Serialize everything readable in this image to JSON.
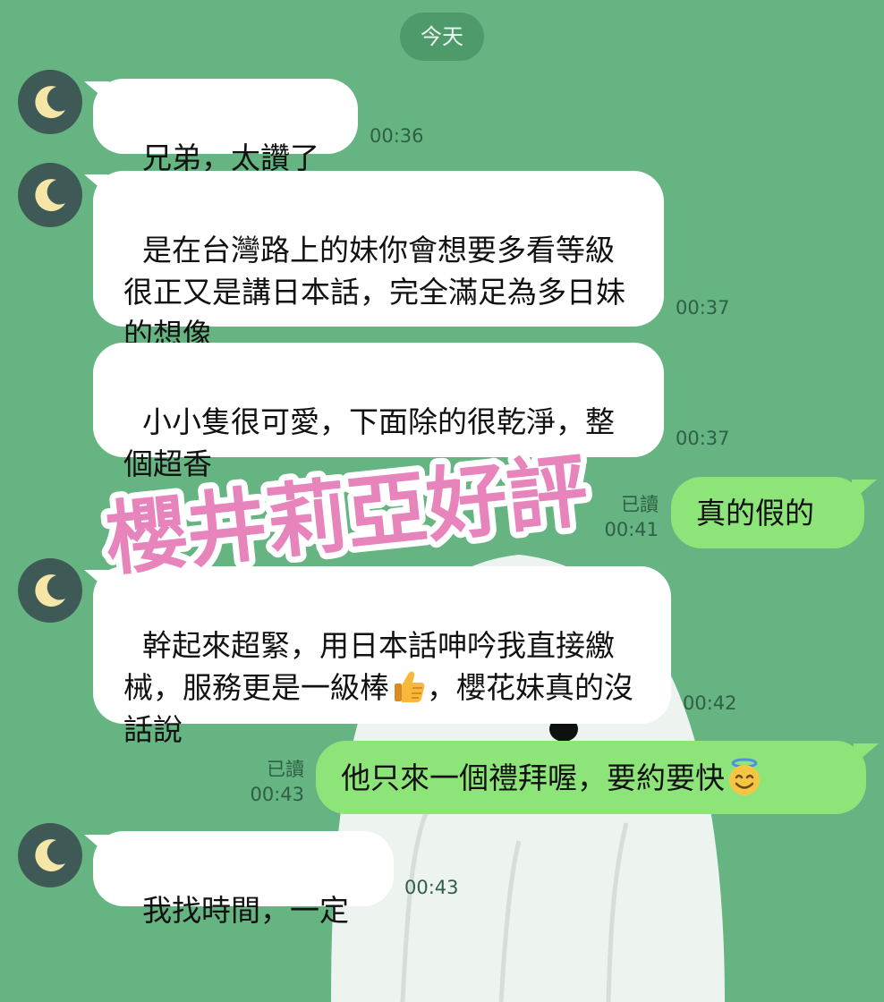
{
  "date_label": "今天",
  "messages": [
    {
      "text": "兄弟，太讚了",
      "time": "00:36"
    },
    {
      "text": "是在台灣路上的妹你會想要多看等級很正又是講日本話，完全滿足為多日妹的想像",
      "time": "00:37"
    },
    {
      "text": "小小隻很可愛，下面除的很乾淨，整個超香",
      "time": "00:37"
    },
    {
      "text": "真的假的",
      "time": "00:41",
      "read": "已讀"
    },
    {
      "text_part1": "幹起來超緊，用日本話呻吟我直接繳械，服務更是一級棒",
      "emoji": "thumbs-up-icon",
      "text_part2": "，櫻花妹真的沒話說",
      "time": "00:42"
    },
    {
      "text": "他只來一個禮拜喔，要約要快",
      "emoji": "smiling-halo-icon",
      "time": "00:43",
      "read": "已讀"
    },
    {
      "text": "我找時間，一定",
      "time": "00:43"
    }
  ],
  "watermark": "櫻井莉亞好評",
  "colors": {
    "background": "#65b481",
    "incoming_bubble": "#ffffff",
    "outgoing_bubble": "#8de57a",
    "avatar": "#3f5956",
    "moon": "#f5e6a8",
    "watermark_fill": "#e784bc",
    "watermark_stroke": "#ffffff"
  }
}
